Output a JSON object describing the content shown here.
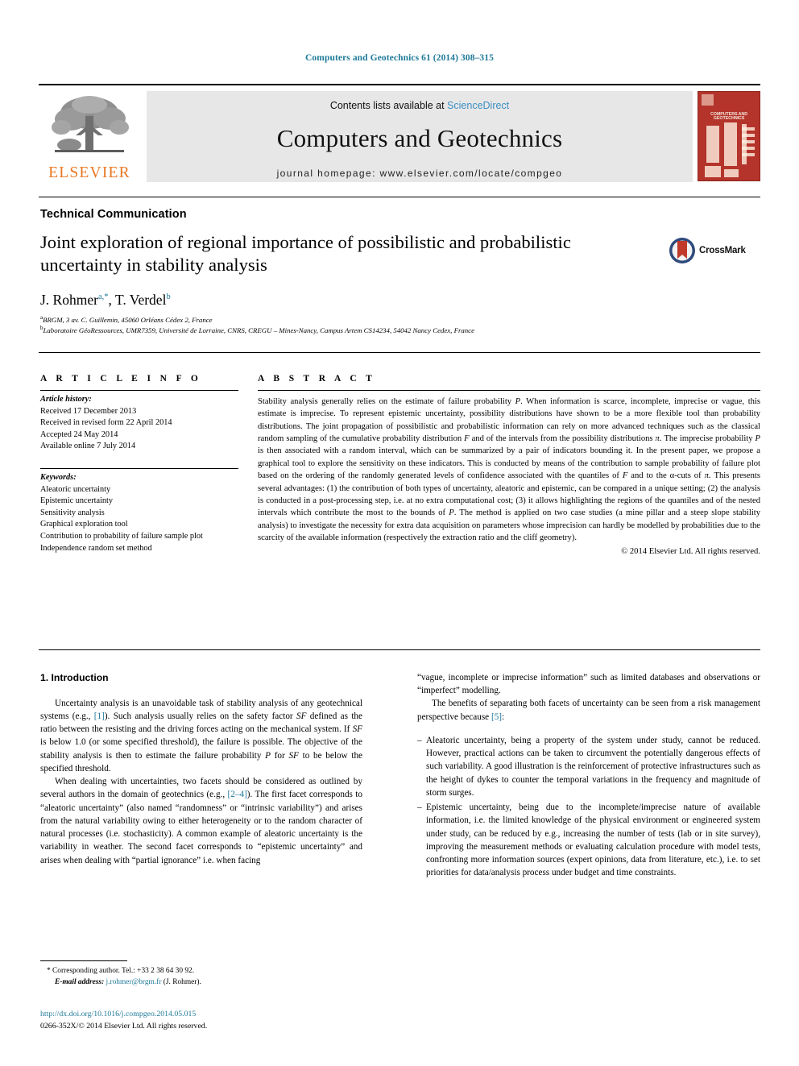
{
  "running_head": "Computers and Geotechnics 61 (2014) 308–315",
  "masthead": {
    "contents_prefix": "Contents lists available at ",
    "sciencedirect": "ScienceDirect",
    "journal_name": "Computers and Geotechnics",
    "homepage": "journal homepage: www.elsevier.com/locate/compgeo",
    "publisher_logo_text": "ELSEVIER",
    "publisher_logo_icon": "elsevier-tree-icon",
    "cover_title": "COMPUTERS AND GEOTECHNICS",
    "accent_color": "#E87722",
    "link_color": "#3c8fc4"
  },
  "article": {
    "type": "Technical Communication",
    "title": "Joint exploration of regional importance of possibilistic and probabilistic uncertainty in stability analysis",
    "crossmark_label": "CrossMark",
    "authors_plain": "J. Rohmer a,*, T. Verdel b",
    "authors": [
      {
        "name": "J. Rohmer",
        "marks": "a,*"
      },
      {
        "name": "T. Verdel",
        "marks": "b"
      }
    ],
    "affiliations": [
      {
        "mark": "a",
        "text": "BRGM, 3 av. C. Guillemin, 45060 Orléans Cédex 2, France"
      },
      {
        "mark": "b",
        "text": "Laboratoire GéoRessources, UMR7359, Université de Lorraine, CNRS, CREGU – Mines-Nancy, Campus Artem CS14234, 54042 Nancy Cedex, France"
      }
    ]
  },
  "article_info": {
    "heading": "A R T I C L E   I N F O",
    "history_label": "Article history:",
    "history": [
      "Received 17 December 2013",
      "Received in revised form 22 April 2014",
      "Accepted 24 May 2014",
      "Available online 7 July 2014"
    ],
    "keywords_label": "Keywords:",
    "keywords": [
      "Aleatoric uncertainty",
      "Epistemic uncertainty",
      "Sensitivity analysis",
      "Graphical exploration tool",
      "Contribution to probability of failure sample plot",
      "Independence random set method"
    ]
  },
  "abstract": {
    "heading": "A B S T R A C T",
    "body_html": "Stability analysis generally relies on the estimate of failure probability <i>P</i>. When information is scarce, incomplete, imprecise or vague, this estimate is imprecise. To represent epistemic uncertainty, possibility distributions have shown to be a more flexible tool than probability distributions. The joint propagation of possibilistic and probabilistic information can rely on more advanced techniques such as the classical random sampling of the cumulative probability distribution <i>F</i> and of the intervals from the possibility distributions <i>π</i>. The imprecise probability <i>P</i> is then associated with a random interval, which can be summarized by a pair of indicators bounding it. In the present paper, we propose a graphical tool to explore the sensitivity on these indicators. This is conducted by means of the contribution to sample probability of failure plot based on the ordering of the randomly generated levels of confidence associated with the quantiles of <i>F</i> and to the α-cuts of <i>π</i>. This presents several advantages: (1) the contribution of both types of uncertainty, aleatoric and epistemic, can be compared in a unique setting; (2) the analysis is conducted in a post-processing step, i.e. at no extra computational cost; (3) it allows highlighting the regions of the quantiles and of the nested intervals which contribute the most to the bounds of <i>P</i>. The method is applied on two case studies (a mine pillar and a steep slope stability analysis) to investigate the necessity for extra data acquisition on parameters whose imprecision can hardly be modelled by probabilities due to the scarcity of the available information (respectively the extraction ratio and the cliff geometry).",
    "copyright": "© 2014 Elsevier Ltd. All rights reserved."
  },
  "introduction": {
    "heading": "1. Introduction",
    "left_paragraphs_html": [
      "Uncertainty analysis is an unavoidable task of stability analysis of any geotechnical systems (e.g., <span class=\"ref\">[1]</span>). Such analysis usually relies on the safety factor <i>SF</i> defined as the ratio between the resisting and the driving forces acting on the mechanical system. If <i>SF</i> is below 1.0 (or some specified threshold), the failure is possible. The objective of the stability analysis is then to estimate the failure probability <i>P</i> for <i>SF</i> to be below the specified threshold.",
      "When dealing with uncertainties, two facets should be considered as outlined by several authors in the domain of geotechnics (e.g., <span class=\"ref\">[2–4]</span>). The first facet corresponds to “aleatoric uncertainty” (also named “randomness” or “intrinsic variability”) and arises from the natural variability owing to either heterogeneity or to the random character of natural processes (i.e. stochasticity). A common example of aleatoric uncertainty is the variability in weather. The second facet corresponds to “epistemic uncertainty” and arises when dealing with “partial ignorance” i.e. when facing"
    ],
    "right_paragraphs_html": [
      "“vague, incomplete or imprecise information” such as limited databases and observations or “imperfect” modelling.",
      "The benefits of separating both facets of uncertainty can be seen from a risk management perspective because <span class=\"ref\">[5]</span>:"
    ],
    "bullets_html": [
      "Aleatoric uncertainty, being a property of the system under study, cannot be reduced. However, practical actions can be taken to circumvent the potentially dangerous effects of such variability. A good illustration is the reinforcement of protective infrastructures such as the height of dykes to counter the temporal variations in the frequency and magnitude of storm surges.",
      "Epistemic uncertainty, being due to the incomplete/imprecise nature of available information, i.e. the limited knowledge of the physical environment or engineered system under study, can be reduced by e.g., increasing the number of tests (lab or in site survey), improving the measurement methods or evaluating calculation procedure with model tests, confronting more information sources (expert opinions, data from literature, etc.), i.e. to set priorities for data/analysis process under budget and time constraints."
    ],
    "bullet_marker": "–"
  },
  "footnote": {
    "corresponding_mark": "*",
    "corresponding_text": "Corresponding author. Tel.: +33 2 38 64 30 92.",
    "email_label": "E-mail address:",
    "email": "j.rohmer@brgm.fr",
    "email_suffix": "(J. Rohmer)."
  },
  "footer": {
    "doi": "http://dx.doi.org/10.1016/j.compgeo.2014.05.015",
    "issn_line": "0266-352X/© 2014 Elsevier Ltd. All rights reserved."
  }
}
